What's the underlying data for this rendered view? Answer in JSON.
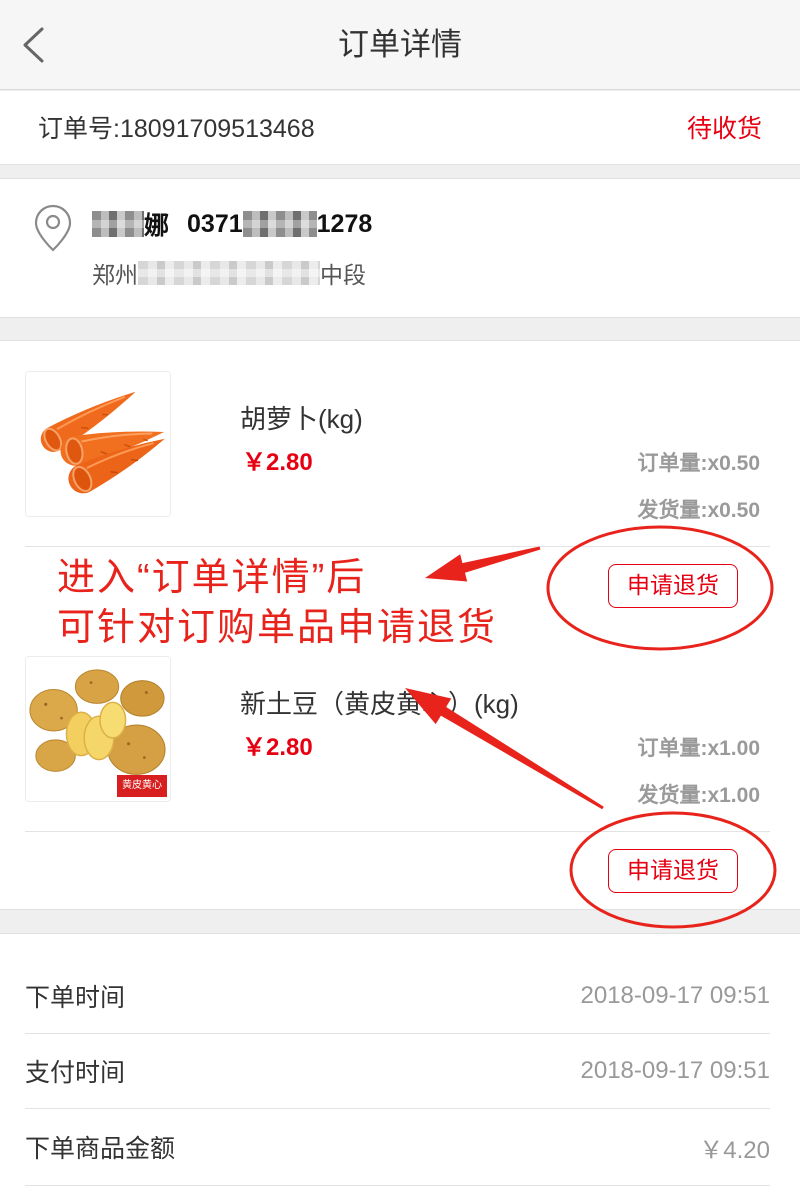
{
  "header": {
    "title": "订单详情",
    "back_icon": "chevron-left-icon"
  },
  "order": {
    "number_label": "订单号:",
    "number": "18091709513468",
    "status": "待收货"
  },
  "address": {
    "icon": "location-pin-icon",
    "name_visible": "娜",
    "phone_start": "0371",
    "phone_end": "1278",
    "addr_start": "郑州",
    "addr_end": "中段"
  },
  "products": [
    {
      "name": "胡萝卜(kg)",
      "price": "￥2.80",
      "order_qty": "订单量:x0.50",
      "ship_qty": "发货量:x0.50",
      "action_label": "申请退货"
    },
    {
      "name": "新土豆（黄皮黄心）(kg)",
      "price": "￥2.80",
      "order_qty": "订单量:x1.00",
      "ship_qty": "发货量:x1.00",
      "image_badge": "黄皮黄心",
      "action_label": "申请退货"
    }
  ],
  "details": [
    {
      "label": "下单时间",
      "value": "2018-09-17 09:51"
    },
    {
      "label": "支付时间",
      "value": "2018-09-17 09:51"
    },
    {
      "label": "下单商品金额",
      "value": "￥4.20"
    }
  ],
  "annotation": {
    "line1": "进入“订单详情”后",
    "line2": "可针对订购单品申请退货"
  },
  "colors": {
    "accent": "#e60012",
    "annotation": "#e8231b",
    "page_background": "#efefef"
  }
}
